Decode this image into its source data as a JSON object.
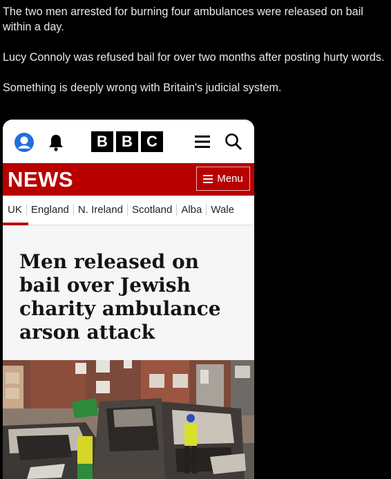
{
  "tweet": {
    "paragraphs": [
      "The two men arrested for burning four ambulances were released on bail within a day.",
      "Lucy Connoly was refused bail for over two months after posting hurty words.",
      "Something is deeply wrong with Britain's judicial system."
    ]
  },
  "bbc": {
    "logo_letters": [
      "B",
      "B",
      "C"
    ],
    "news_label": "NEWS",
    "menu_label": "Menu",
    "nations": [
      "UK",
      "England",
      "N. Ireland",
      "Scotland",
      "Alba",
      "Wale"
    ],
    "headline": "Men released on bail over Jewish charity ambulance arson attack",
    "icons": [
      "account-icon",
      "bell-icon",
      "menu-icon",
      "search-icon"
    ],
    "colors": {
      "brand_red": "#b80000",
      "account_blue": "#1f6fe0"
    }
  }
}
